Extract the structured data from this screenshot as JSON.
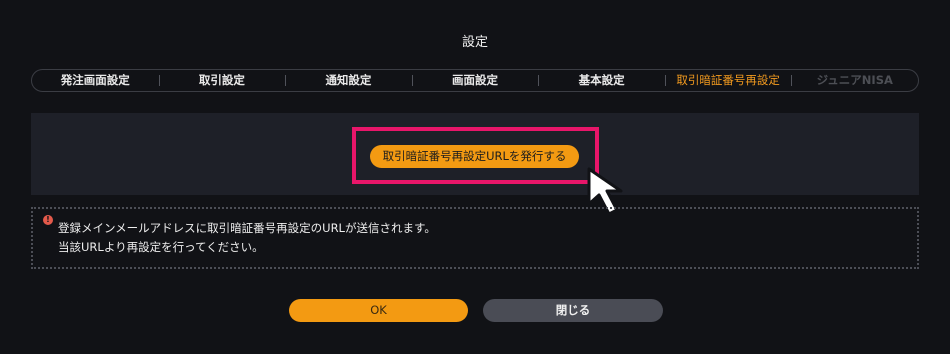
{
  "dialog": {
    "title": "設定"
  },
  "tabs": [
    {
      "label": "発注画面設定",
      "state": "normal"
    },
    {
      "label": "取引設定",
      "state": "normal"
    },
    {
      "label": "通知設定",
      "state": "normal"
    },
    {
      "label": "画面設定",
      "state": "normal"
    },
    {
      "label": "基本設定",
      "state": "normal"
    },
    {
      "label": "取引暗証番号再設定",
      "state": "active"
    },
    {
      "label": "ジュニアNISA",
      "state": "disabled"
    }
  ],
  "panel": {
    "issue_button_label": "取引暗証番号再設定URLを発行する"
  },
  "notice": {
    "icon": "info-icon",
    "line1": "登録メインメールアドレスに取引暗証番号再設定のURLが送信されます。",
    "line2": "当該URLより再設定を行ってください。"
  },
  "footer": {
    "ok_label": "OK",
    "close_label": "閉じる"
  },
  "colors": {
    "background": "#111216",
    "panel": "#1e2028",
    "accent": "#f39a12",
    "highlight": "#e8166a",
    "secondary_button": "#4a4c55",
    "disabled_tab": "#4d4f55",
    "notice_icon": "#e45a4b"
  }
}
